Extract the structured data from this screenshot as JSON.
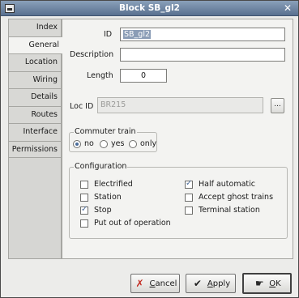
{
  "window": {
    "title": "Block SB_gl2",
    "close_glyph": "✕"
  },
  "tabs": [
    {
      "label": "Index",
      "active": false
    },
    {
      "label": "General",
      "active": true
    },
    {
      "label": "Location",
      "active": false
    },
    {
      "label": "Wiring",
      "active": false
    },
    {
      "label": "Details",
      "active": false
    },
    {
      "label": "Routes",
      "active": false
    },
    {
      "label": "Interface",
      "active": false
    },
    {
      "label": "Permissions",
      "active": false
    }
  ],
  "general": {
    "id_label": "ID",
    "id_value": "SB_gl2",
    "description_label": "Description",
    "description_value": "",
    "length_label": "Length",
    "length_value": "0",
    "locid_label": "Loc ID",
    "locid_value": "BR215",
    "locid_button": "...",
    "commuter": {
      "title": "Commuter train",
      "options": [
        "no",
        "yes",
        "only"
      ],
      "selected": "no"
    },
    "configuration": {
      "title": "Configuration",
      "electrified": {
        "label": "Electrified",
        "checked": false
      },
      "station": {
        "label": "Station",
        "checked": false
      },
      "stop": {
        "label": "Stop",
        "checked": true
      },
      "put_out": {
        "label": "Put out of operation",
        "checked": false
      },
      "half_automatic": {
        "label": "Half automatic",
        "checked": true
      },
      "accept_ghost": {
        "label": "Accept ghost trains",
        "checked": false
      },
      "terminal": {
        "label": "Terminal station",
        "checked": false
      }
    }
  },
  "buttons": {
    "cancel_mn": "C",
    "cancel_rest": "ancel",
    "apply_mn": "A",
    "apply_rest": "pply",
    "ok_mn": "O",
    "ok_rest": "K"
  },
  "icons": {
    "window": "app-icon",
    "cancel": "cancel-x-icon",
    "apply": "checkmark-icon",
    "ok": "ok-hand-icon"
  }
}
